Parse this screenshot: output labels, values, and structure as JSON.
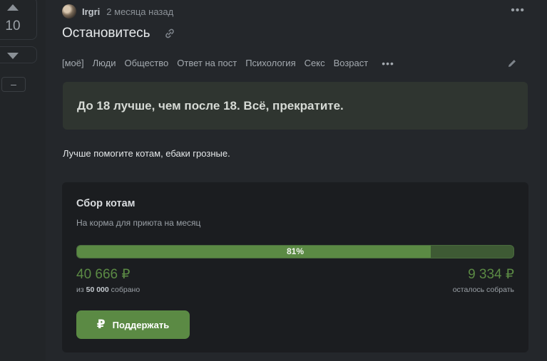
{
  "vote": {
    "count": "10",
    "minus_label": "–"
  },
  "post": {
    "author": "Irgri",
    "time": "2 месяца назад",
    "title": "Остановитесь",
    "tags": [
      "[моё]",
      "Люди",
      "Общество",
      "Ответ на пост",
      "Психология",
      "Секс",
      "Возраст"
    ],
    "more_tags": "•••",
    "menu": "•••",
    "quote": "До 18 лучше, чем после 18. Всё, прекратите.",
    "body": "Лучше помогите котам, ебаки грозные."
  },
  "fundraiser": {
    "title": "Сбор котам",
    "subtitle": "На корма для приюта на месяц",
    "progress_label": "81%",
    "progress_fraction": 0.81,
    "collected": "40 666 ₽",
    "collected_note_prefix": "из",
    "goal": "50 000",
    "collected_note_suffix": "собрано",
    "remaining": "9 334 ₽",
    "remaining_note": "осталось собрать",
    "button_icon": "₽",
    "button_label": "Поддержать"
  },
  "colors": {
    "background": "#24272b",
    "accent_green": "#5b8a44",
    "quote_bg": "#2f3530",
    "card_bg": "#1b1d20"
  },
  "icons": [
    "arrow-up-icon",
    "arrow-down-icon",
    "link-icon",
    "edit-icon",
    "ruble-icon"
  ]
}
